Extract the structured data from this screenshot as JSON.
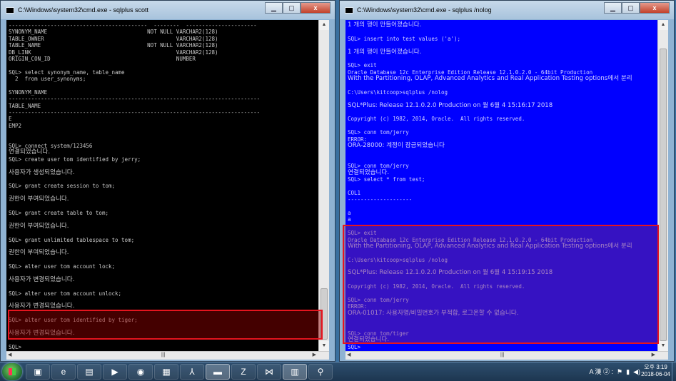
{
  "left_window": {
    "title": "C:\\Windows\\system32\\cmd.exe - sqlplus  scott",
    "buttons": {
      "minimize": "▁",
      "maximize": "▢",
      "close": "x"
    },
    "lines": [
      "-------------------------------------------  --------  ----------------------",
      "SYNONYM_NAME                               NOT NULL VARCHAR2(128)",
      "TABLE_OWNER                                         VARCHAR2(128)",
      "TABLE_NAME                                 NOT NULL VARCHAR2(128)",
      "DB_LINK                                             VARCHAR2(128)",
      "ORIGIN_CON_ID                                       NUMBER",
      "",
      "SQL> select synonym_name, table_name",
      "  2  from user_synonyms;",
      "",
      "SYNONYM_NAME",
      "------------------------------------------------------------------------------",
      "TABLE_NAME",
      "------------------------------------------------------------------------------",
      "E",
      "EMP2",
      "",
      "",
      "SQL> connect system/123456",
      "연결되었습니다.",
      "SQL> create user tom identified by jerry;",
      "",
      "사용자가 생성되었습니다.",
      "",
      "SQL> grant create session to tom;",
      "",
      "권한이 부여되었습니다.",
      "",
      "SQL> grant create table to tom;",
      "",
      "권한이 부여되었습니다.",
      "",
      "SQL> grant unlimited tablespace to tom;",
      "",
      "권한이 부여되었습니다.",
      "",
      "SQL> alter user tom account lock;",
      "",
      "사용자가 변경되었습니다.",
      "",
      "SQL> alter user tom account unlock;",
      "",
      "사용자가 변경되었습니다.",
      "",
      "SQL> alter user tom identified by tiger;",
      "",
      "사용자가 변경되었습니다.",
      "",
      "SQL>"
    ]
  },
  "right_window": {
    "title": "C:\\Windows\\system32\\cmd.exe - sqlplus  /nolog",
    "buttons": {
      "minimize": "▁",
      "maximize": "▢",
      "close": "x"
    },
    "lines": [
      "1 개의 행이 만들어졌습니다.",
      "",
      "SQL> insert into test values ('a');",
      "",
      "1 개의 행이 만들어졌습니다.",
      "",
      "SQL> exit",
      "Oracle Database 12c Enterprise Edition Release 12.1.0.2.0 - 64bit Production",
      "With the Partitioning, OLAP, Advanced Analytics and Real Application Testing options에서 분리",
      "",
      "C:\\Users\\kitcoop>sqlplus /nolog",
      "",
      "SQL*Plus: Release 12.1.0.2.0 Production on 월 6월 4 15:16:17 2018",
      "",
      "Copyright (c) 1982, 2014, Oracle.  All rights reserved.",
      "",
      "SQL> conn tom/jerry",
      "ERROR:",
      "ORA-28000: 계정이 잠금되었습니다",
      "",
      "",
      "SQL> conn tom/jerry",
      "연결되었습니다.",
      "SQL> select * from test;",
      "",
      "COL1",
      "--------------------",
      "",
      "a",
      "a",
      "",
      "SQL> exit",
      "Oracle Database 12c Enterprise Edition Release 12.1.0.2.0 - 64bit Production",
      "With the Partitioning, OLAP, Advanced Analytics and Real Application Testing options에서 분리",
      "",
      "C:\\Users\\kitcoop>sqlplus /nolog",
      "",
      "SQL*Plus: Release 12.1.0.2.0 Production on 월 6월 4 15:19:15 2018",
      "",
      "Copyright (c) 1982, 2014, Oracle.  All rights reserved.",
      "",
      "SQL> conn tom/jerry",
      "ERROR:",
      "ORA-01017: 사용자명/비밀번호가 부적합, 로그온할 수 없습니다.",
      "",
      "",
      "SQL> conn tom/tiger",
      "연결되었습니다.",
      "SQL>"
    ]
  },
  "taskbar": {
    "apps": [
      "windows-explorer",
      "internet-explorer",
      "file-manager",
      "media-player",
      "chrome",
      "pdf-viewer",
      "acrobat",
      "cmd",
      "filezilla",
      "visual-studio-code",
      "database-tool",
      "search-tool"
    ],
    "tray_text": "A 漢 ② :",
    "clock_time": "오후 3:19",
    "clock_date": "2018-06-04"
  }
}
